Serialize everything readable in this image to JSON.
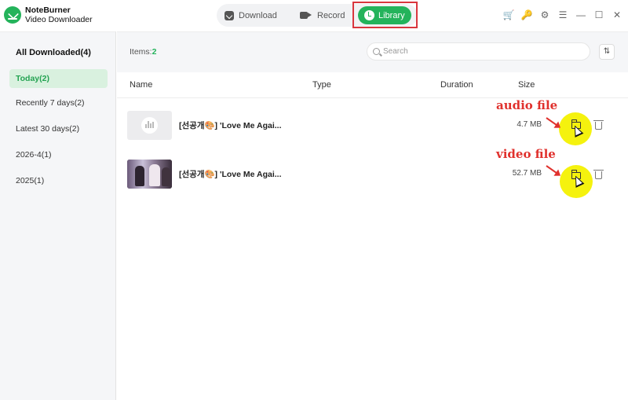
{
  "app": {
    "name_line1": "NoteBurner",
    "name_line2": "Video Downloader"
  },
  "nav": {
    "download": "Download",
    "record": "Record",
    "library": "Library",
    "active": "Library"
  },
  "window_icons": [
    "cart-icon",
    "key-icon",
    "gear-icon",
    "menu-icon",
    "minimize-icon",
    "maximize-icon",
    "close-icon"
  ],
  "sidebar": {
    "items": [
      {
        "label": "All Downloaded(4)"
      },
      {
        "label": "Today(2)",
        "selected": true
      },
      {
        "label": "Recently 7 days(2)"
      },
      {
        "label": "Latest 30 days(2)"
      },
      {
        "label": "2026-4(1)"
      },
      {
        "label": "2025(1)"
      }
    ]
  },
  "toolbar": {
    "items_label": "Items:",
    "items_count": "2",
    "search_placeholder": "Search"
  },
  "table": {
    "columns": [
      "Name",
      "Type",
      "Duration",
      "Size"
    ],
    "rows": [
      {
        "title": "[선공개🎨] 'Love Me Agai...",
        "type": "",
        "duration": "",
        "size": "4.7 MB",
        "thumb": "audio"
      },
      {
        "title": "[선공개🎨] 'Love Me Agai...",
        "type": "",
        "duration": "",
        "size": "52.7 MB",
        "thumb": "video"
      }
    ]
  },
  "annotations": {
    "audio": "audio file",
    "video": "video file"
  },
  "colors": {
    "accent": "#24b35b",
    "annotation": "#e0312d",
    "highlight": "#f5f20e",
    "selection_box": "#d9363e"
  }
}
